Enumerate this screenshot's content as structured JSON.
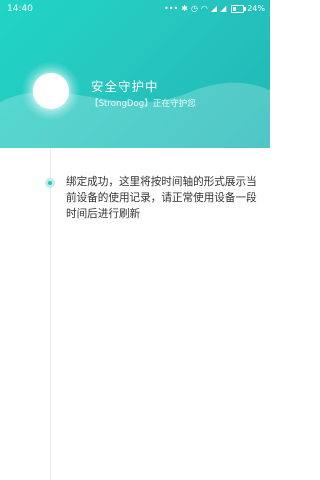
{
  "status_bar": {
    "time": "14:40",
    "battery": "24%",
    "icons": [
      "dots-icon",
      "bluetooth-icon",
      "clock-icon",
      "wifi-icon",
      "signal-icon",
      "signal-icon",
      "battery-icon"
    ]
  },
  "header": {
    "title": "安全守护中",
    "subtitle": "【StrongDog】正在守护您"
  },
  "timeline": {
    "message": "绑定成功，这里将按时间轴的形式展示当前设备的使用记录，请正常使用设备一段时间后进行刷新"
  },
  "colors": {
    "accent": "#22c9bd",
    "header_start": "#1fd6c6",
    "header_end": "#1fb7b6"
  }
}
